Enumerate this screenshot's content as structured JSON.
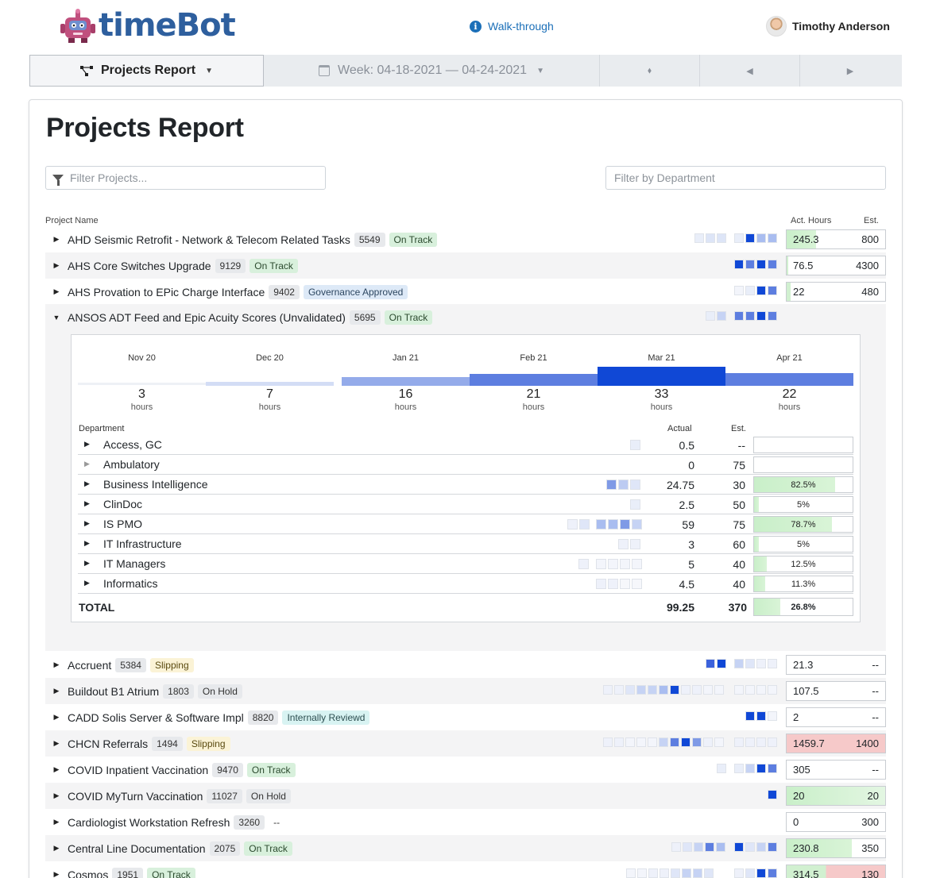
{
  "app": {
    "title": "timeBot",
    "walkthrough_icon": "info-icon",
    "walkthrough": "Walk-through",
    "user_name": "Timothy Anderson"
  },
  "toolbar": {
    "report_label": "Projects Report",
    "week_label": "Week: 04-18-2021 — 04-24-2021",
    "sort_icon": "sort-icon",
    "prev_icon": "chevron-left-icon",
    "next_icon": "chevron-right-icon"
  },
  "page": {
    "title": "Projects Report",
    "filter_projects_placeholder": "Filter Projects...",
    "filter_department_placeholder": "Filter by Department"
  },
  "columns": {
    "project_name": "Project Name",
    "act_hours": "Act. Hours",
    "est": "Est."
  },
  "colors": {
    "sq_light": "#e9eef9",
    "sq_mid": "#a9bdf0",
    "sq_strong": "#5d7ee0",
    "sq_dark": "#1048d6",
    "over_budget": "#f6c9c9",
    "under_budget": "#d1f0d0"
  },
  "projects": [
    {
      "name": "AHD Seismic Retrofit - Network & Telecom Related Tasks",
      "id": "5549",
      "status": "On Track",
      "actual": "245.3",
      "est": "800"
    },
    {
      "name": "AHS Core Switches Upgrade",
      "id": "9129",
      "status": "On Track",
      "actual": "76.5",
      "est": "4300"
    },
    {
      "name": "AHS Provation to EPic Charge Interface",
      "id": "9402",
      "status": "Governance Approved",
      "actual": "22",
      "est": "480"
    },
    {
      "name": "ANSOS ADT Feed and Epic Acuity Scores (Unvalidated)",
      "id": "5695",
      "status": "On Track"
    },
    {
      "name": "Accruent",
      "id": "5384",
      "status": "Slipping",
      "actual": "21.3",
      "est": "--"
    },
    {
      "name": "Buildout B1 Atrium",
      "id": "1803",
      "status": "On Hold",
      "actual": "107.5",
      "est": "--"
    },
    {
      "name": "CADD Solis Server & Software Impl",
      "id": "8820",
      "status": "Internally Reviewd",
      "actual": "2",
      "est": "--"
    },
    {
      "name": "CHCN Referrals",
      "id": "1494",
      "status": "Slipping",
      "actual": "1459.7",
      "est": "1400"
    },
    {
      "name": "COVID Inpatient Vaccination",
      "id": "9470",
      "status": "On Track",
      "actual": "305",
      "est": "--"
    },
    {
      "name": "COVID MyTurn Vaccination",
      "id": "11027",
      "status": "On Hold",
      "actual": "20",
      "est": "20"
    },
    {
      "name": "Cardiologist Workstation Refresh",
      "id": "3260",
      "status": "--",
      "actual": "0",
      "est": "300"
    },
    {
      "name": "Central Line Documentation",
      "id": "2075",
      "status": "On Track",
      "actual": "230.8",
      "est": "350"
    },
    {
      "name": "Cosmos",
      "id": "1951",
      "status": "On Track",
      "actual": "314.5",
      "est": "130"
    }
  ],
  "detail": {
    "months": [
      {
        "label": "Nov 20",
        "value": "3",
        "unit": "hours"
      },
      {
        "label": "Dec 20",
        "value": "7",
        "unit": "hours"
      },
      {
        "label": "Jan 21",
        "value": "16",
        "unit": "hours"
      },
      {
        "label": "Feb 21",
        "value": "21",
        "unit": "hours"
      },
      {
        "label": "Mar 21",
        "value": "33",
        "unit": "hours"
      },
      {
        "label": "Apr 21",
        "value": "22",
        "unit": "hours"
      }
    ],
    "headers": {
      "department": "Department",
      "actual": "Actual",
      "est": "Est."
    },
    "rows": [
      {
        "name": "Access, GC",
        "actual": "0.5",
        "est": "--",
        "pct": ""
      },
      {
        "name": "Ambulatory",
        "actual": "0",
        "est": "75",
        "pct": ""
      },
      {
        "name": "Business Intelligence",
        "actual": "24.75",
        "est": "30",
        "pct": "82.5%"
      },
      {
        "name": "ClinDoc",
        "actual": "2.5",
        "est": "50",
        "pct": "5%"
      },
      {
        "name": "IS PMO",
        "actual": "59",
        "est": "75",
        "pct": "78.7%"
      },
      {
        "name": "IT Infrastructure",
        "actual": "3",
        "est": "60",
        "pct": "5%"
      },
      {
        "name": "IT Managers",
        "actual": "5",
        "est": "40",
        "pct": "12.5%"
      },
      {
        "name": "Informatics",
        "actual": "4.5",
        "est": "40",
        "pct": "11.3%"
      }
    ],
    "total": {
      "label": "TOTAL",
      "actual": "99.25",
      "est": "370",
      "pct": "26.8%"
    }
  }
}
